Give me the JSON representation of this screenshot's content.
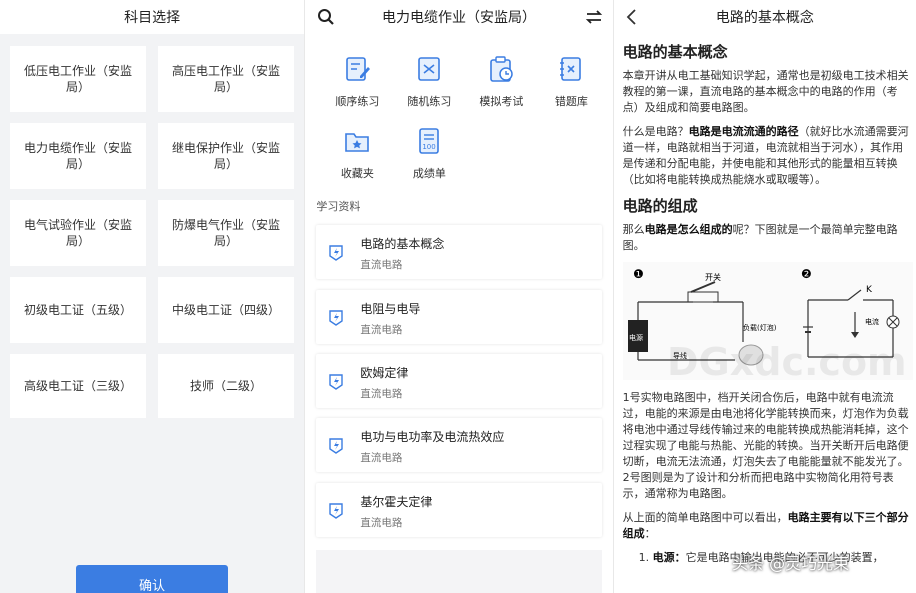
{
  "panel1": {
    "title": "科目选择",
    "cards": [
      "低压电工作业（安监局）",
      "高压电工作业（安监局）",
      "电力电缆作业（安监局）",
      "继电保护作业（安监局）",
      "电气试验作业（安监局）",
      "防爆电气作业（安监局）",
      "初级电工证（五级）",
      "中级电工证（四级）",
      "高级电工证（三级）",
      "技师（二级）"
    ],
    "confirm": "确认"
  },
  "panel2": {
    "title": "电力电缆作业（安监局）",
    "tools": [
      "顺序练习",
      "随机练习",
      "模拟考试",
      "错题库",
      "收藏夹",
      "成绩单"
    ],
    "section": "学习资料",
    "materials": [
      {
        "title": "电路的基本概念",
        "sub": "直流电路"
      },
      {
        "title": "电阻与电导",
        "sub": "直流电路"
      },
      {
        "title": "欧姆定律",
        "sub": "直流电路"
      },
      {
        "title": "电功与电功率及电流热效应",
        "sub": "直流电路"
      },
      {
        "title": "基尔霍夫定律",
        "sub": "直流电路"
      }
    ],
    "accent": "#3b7de2"
  },
  "panel3": {
    "title": "电路的基本概念",
    "h1": "电路的基本概念",
    "p1": "本章开讲从电工基础知识学起，通常也是初级电工技术相关教程的第一课，直流电路的基本概念中的电路的作用（考点）及组成和简要电路图。",
    "p2a": "什么是电路？",
    "p2b": "电路是电流流通的路径",
    "p2c": "（就好比水流通需要河道一样，电路就相当于河道，电流就相当于河水），其作用是传递和分配电能，并使电能和其他形式的能量相互转换（比如将电能转换成热能烧水或取暖等）。",
    "h2": "电路的组成",
    "p3a": "那么",
    "p3b": "电路是怎么组成的",
    "p3c": "呢？下图就是一个最简单完整电路图。",
    "fig_labels": {
      "n1": "❶",
      "n2": "❷",
      "switch": "开关",
      "power": "电源",
      "load": "负载(灯泡)",
      "wire": "导线",
      "k": "K",
      "current": "电流"
    },
    "watermark": "DGxdc.com",
    "p4": "1号实物电路图中，档开关闭合伤后，电路中就有电流流过，电能的来源是由电池将化学能转换而来，灯泡作为负载将电池中通过导线传输过来的电能转换成热能消耗掉，这个过程实现了电能与热能、光能的转换。当开关断开后电路便切断，电流无法流通，灯泡失去了电能能量就不能发光了。2号图则是为了设计和分析而把电路中实物简化用符号表示，通常称为电路图。",
    "p5a": "从上面的简单电路图中可以看出，",
    "p5b": "电路主要有以下三个部分组成",
    "p5c": "：",
    "li1a": "电源：",
    "li1b": "它是电路中输出电能的必不可少的装置，",
    "badge": "头条 @灵巧光束"
  }
}
